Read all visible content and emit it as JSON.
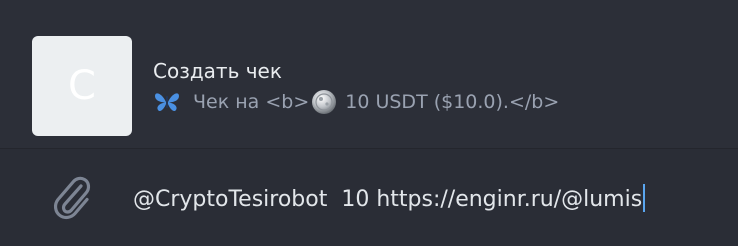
{
  "inline_result": {
    "thumb_letter": "C",
    "title": "Создать чек",
    "desc_before": "Чек на <b>",
    "desc_after": " 10 USDT ($10.0).</b>"
  },
  "composer": {
    "input_value": "@CryptoTesirobot  10 https://enginr.ru/@lumis"
  },
  "colors": {
    "background": "#2a2d36",
    "caret": "#5aa6f0",
    "butterfly": "#4a90e2"
  },
  "icons": {
    "attach": "paperclip-icon",
    "butterfly": "butterfly-emoji",
    "coin": "coin-emoji"
  }
}
